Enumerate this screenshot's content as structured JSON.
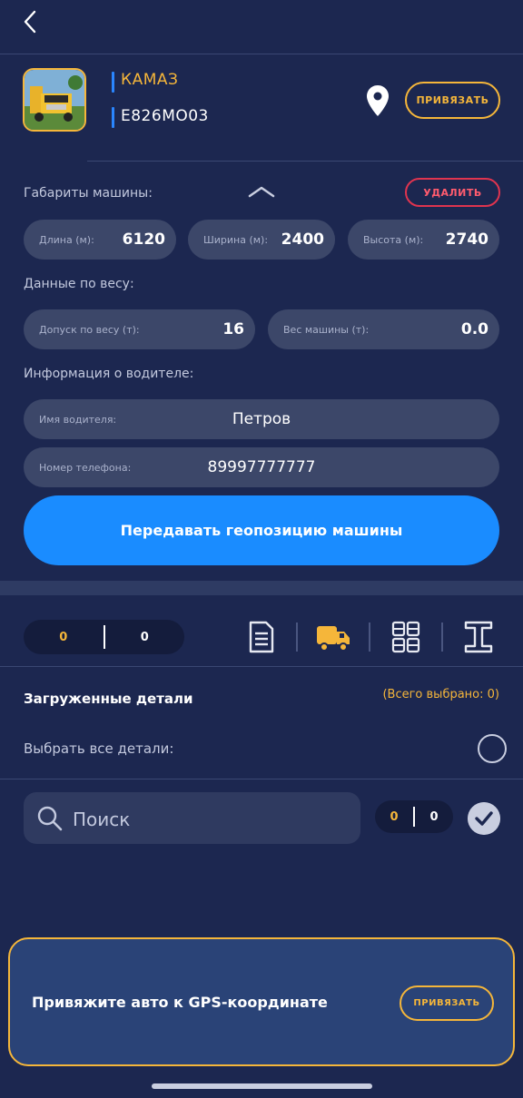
{
  "header": {
    "back_icon": "chevron-left-icon"
  },
  "vehicle": {
    "brand": "КАМАЗ",
    "plate": "E826MO03",
    "location_icon": "map-pin-icon",
    "bind_label": "ПРИВЯЗАТЬ"
  },
  "dimensions": {
    "title": "Габариты машины:",
    "collapse_icon": "chevron-up-icon",
    "delete_label": "УДАЛИТЬ",
    "length": {
      "label": "Длина (м):",
      "value": "6120"
    },
    "width": {
      "label": "Ширина (м):",
      "value": "2400"
    },
    "height": {
      "label": "Высота (м):",
      "value": "2740"
    }
  },
  "weight": {
    "title": "Данные по весу:",
    "tolerance": {
      "label": "Допуск по весу (т):",
      "value": "16"
    },
    "vehicle_weight": {
      "label": "Вес машины (т):",
      "value": "0.0"
    }
  },
  "driver": {
    "title": "Информация о водителе:",
    "name": {
      "label": "Имя водителя:",
      "value": "Петров"
    },
    "phone": {
      "label": "Номер телефона:",
      "value": "89997777777"
    }
  },
  "geo_button": "Передавать геопозицию машины",
  "toolbar": {
    "counter_a": "0",
    "counter_b": "0",
    "tools": [
      "document-icon",
      "truck-icon",
      "grid-icon",
      "i-beam-icon"
    ],
    "active_color": "#f5b63a"
  },
  "loaded": {
    "title": "Загруженные детали",
    "total": "(Всего выбрано: 0)",
    "select_all": "Выбрать все детали:"
  },
  "search": {
    "placeholder": "Поиск",
    "counter_a": "0",
    "counter_b": "0"
  },
  "banner": {
    "text": "Привяжите авто к GPS-координате",
    "button": "ПРИВЯЗАТЬ"
  },
  "colors": {
    "background": "#1c2750",
    "accent": "#f5b63a",
    "primary": "#1a8cff",
    "danger": "#e0344f"
  }
}
